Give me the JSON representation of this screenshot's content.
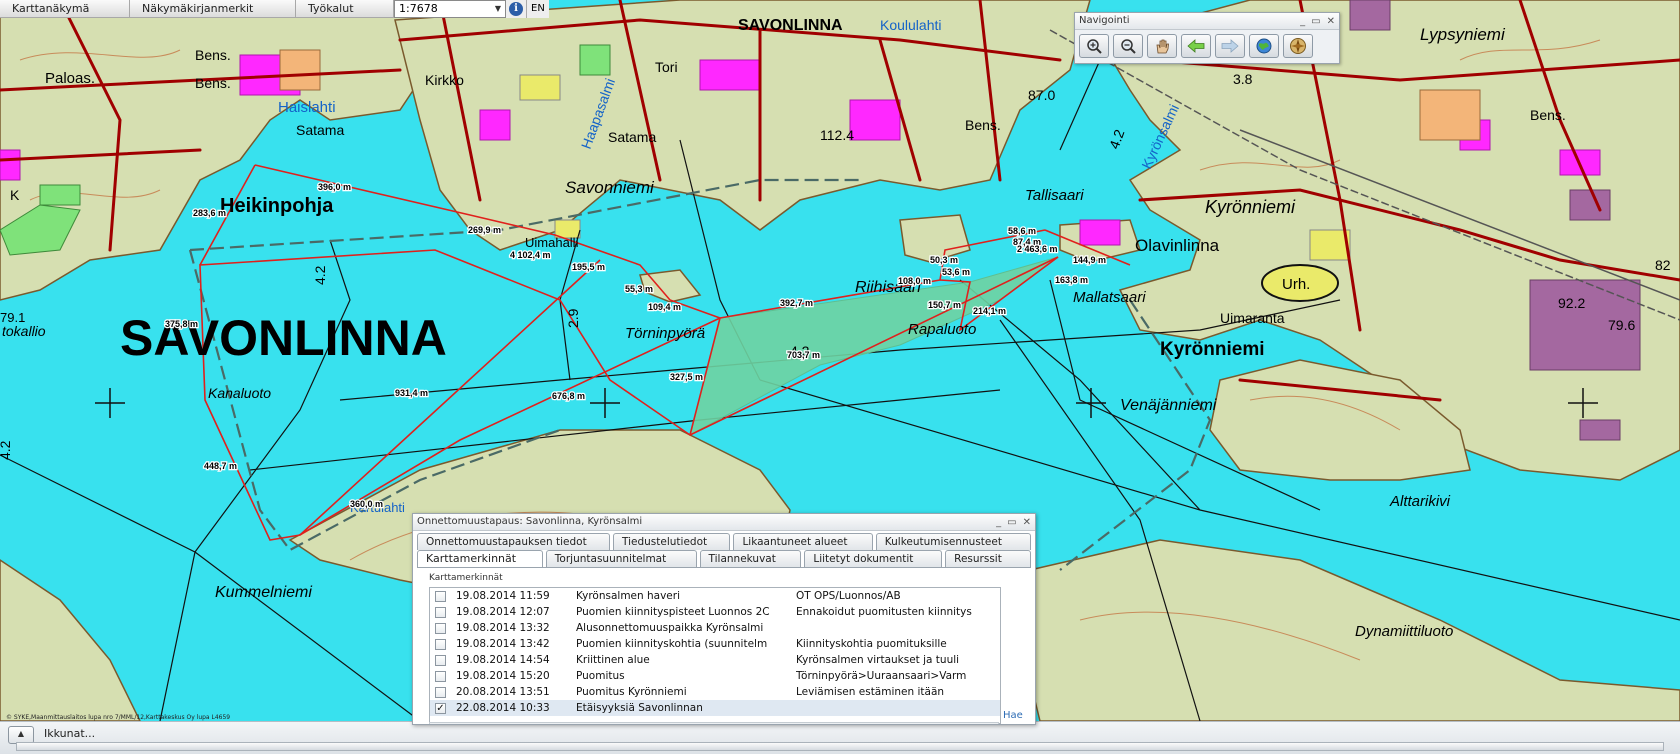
{
  "toolbar": {
    "items": [
      "Karttanäkymä",
      "Näkymäkirjanmerkit",
      "Työkalut"
    ],
    "scale": "1:7678",
    "info_icon": "info-icon",
    "lang": "EN"
  },
  "navigation": {
    "title": "Navigointi",
    "buttons": [
      "zoom-in-icon",
      "zoom-out-icon",
      "pan-hand-icon",
      "back-arrow-icon",
      "forward-arrow-icon",
      "globe-icon",
      "compass-icon"
    ]
  },
  "map": {
    "place_names": {
      "savonlinna_big": "SAVONLINNA",
      "savonlinna_top": "SAVONLINNA",
      "koululahti_top": "Koululahti",
      "heikinpohja": "Heikinpohja",
      "savonniemi": "Savonniemi",
      "satama1": "Satama",
      "satama2": "Satama",
      "haislahti": "Haislahti",
      "haapasalmi": "Haapasalmi",
      "kirkko": "Kirkko",
      "paloas": "Paloas.",
      "bens1": "Bens.",
      "bens2": "Bens.",
      "bens3": "Bens.",
      "bens4": "Bens.",
      "tori": "Tori",
      "uimahalli": "Uimahalli",
      "tornipyora": "Törninpyörä",
      "riihisaari": "Riihisaari",
      "rapaluoto": "Rapaluoto",
      "mallatsaari": "Mallatsaari",
      "tallisaari": "Tallisaari",
      "olavinlinna": "Olavinlinna",
      "kyronniemi1": "Kyrönniemi",
      "kyronniemi2": "Kyrönniemi",
      "kyronsalmi": "Kyrönsalmi",
      "uimaranta": "Uimaranta",
      "urh": "Urh.",
      "venajanniemi": "Venäjänniemi",
      "alttarikivi": "Alttarikivi",
      "dynamiittiluoto": "Dynamiittiluoto",
      "kummelniemi": "Kummelniemi",
      "kanaluoto": "Kanaluoto",
      "kartulahti": "Kartulahti",
      "tokallio": "tokallio",
      "lypsyniemi": "Lypsyniemi",
      "k": "K",
      "n82": "82",
      "n92": "92.2",
      "n79": "79.6",
      "n791": "79.1",
      "n87": "87.0",
      "n42a": "4.2",
      "n42b": "4.2",
      "n42c": "4.2",
      "n42d": "4.2",
      "n29": "2.9",
      "n38": "3.8",
      "n124": "112.4"
    },
    "distances": [
      "396,0 m",
      "283,6 m",
      "269,9 m",
      "4 102,4 m",
      "195,5 m",
      "55,3 m",
      "109,4 m",
      "392,7 m",
      "375,8 m",
      "931,4 m",
      "676,8 m",
      "327,5 m",
      "703,7 m",
      "108,0 m",
      "150,7 m",
      "214,1 m",
      "50,3 m",
      "53,6 m",
      "87,4 m",
      "58,6 m",
      "2 463,6 m",
      "144,9 m",
      "163,8 m",
      "448,7 m",
      "360,0 m"
    ],
    "attribution": "© SYKE,Maanmittauslaitos lupa nro 7/MML/12,Karttakeskus Oy lupa L4659"
  },
  "incident": {
    "title": "Onnettomuustapaus: Savonlinna, Kyrönsalmi",
    "tabs_row1": [
      "Onnettomuustapauksen tiedot",
      "Tiedustelutiedot",
      "Likaantuneet alueet",
      "Kulkeutumisennusteet"
    ],
    "tabs_row2": [
      "Karttamerkinnät",
      "Torjuntasuunnitelmat",
      "Tilannekuvat",
      "Liitetyt dokumentit",
      "Resurssit"
    ],
    "section_label": "Karttamerkinnät",
    "rows": [
      {
        "date": "19.08.2014 11:59",
        "desc": "Kyrönsalmen haveri",
        "source": "ÖT OPS/Luonnos/AB",
        "checked": false
      },
      {
        "date": "19.08.2014 12:07",
        "desc": "Puomien kiinnityspisteet Luonnos 2C",
        "source": "Ennakoidut puomitusten kiinnitys",
        "checked": false
      },
      {
        "date": "19.08.2014 13:32",
        "desc": "Alusonnettomuuspaikka Kyrönsalmi",
        "source": "",
        "checked": false
      },
      {
        "date": "19.08.2014 13:42",
        "desc": "Puomien kiinnityskohtia (suunnitelm",
        "source": "Kiinnityskohtia puomituksille",
        "checked": false
      },
      {
        "date": "19.08.2014 14:54",
        "desc": "Kriittinen alue",
        "source": "Kyrönsalmen virtaukset ja tuuli",
        "checked": false
      },
      {
        "date": "19.08.2014 15:20",
        "desc": "Puomitus",
        "source": "Törninpyörä>Uuraansaari>Varm",
        "checked": false
      },
      {
        "date": "20.08.2014 13:51",
        "desc": "Puomitus Kyrönniemi",
        "source": "Leviämisen estäminen itään",
        "checked": false
      },
      {
        "date": "22.08.2014 10:33",
        "desc": "Etäisyyksiä Savonlinnan",
        "source": "",
        "checked": true
      }
    ],
    "hae": "Hae"
  },
  "bottom": {
    "windows_label": "Ikkunat..."
  }
}
